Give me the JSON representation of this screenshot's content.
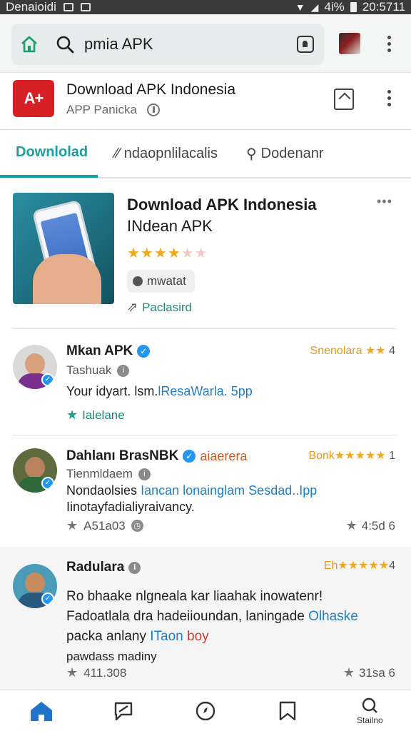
{
  "status_bar": {
    "carrier": "Denaioidi",
    "battery": "4i%",
    "time": "20:5711"
  },
  "browser": {
    "url_text": "pmia APK",
    "icons": [
      "home-icon",
      "search-icon",
      "tab-switch-icon",
      "profile-avatar",
      "overflow-menu-icon"
    ]
  },
  "app_header": {
    "logo_text": "A+",
    "title": "Download APK Indonesia",
    "subtitle": "APP Panicka"
  },
  "tabs": [
    {
      "label": "Downlolad",
      "active": true
    },
    {
      "label": "ndaopnlilacalis",
      "active": false
    },
    {
      "label": "Dodenanr",
      "active": false
    }
  ],
  "featured": {
    "title": "Download APK Indonesia",
    "subtitle": "INdean APK",
    "rating": 3.5,
    "chip_label": "mwatat",
    "link_label": "Paclasird",
    "more": "•••"
  },
  "reviews": [
    {
      "name": "Mkan APK",
      "tag": "",
      "handle": "Tashuak",
      "rating_label": "Snenolara",
      "rating_stars": "★★",
      "rating_num": "4",
      "text_plain": "Your idyart. lsm.",
      "text_link": "lResaWarla. 5pp",
      "action_label": "Ialelane",
      "meta_left": "",
      "meta_right": ""
    },
    {
      "name": "Dahlanı BrasNBK",
      "tag": "aiaerera",
      "handle": "Tienmldaem",
      "rating_label": "Bonk",
      "rating_stars": "★★★★★",
      "rating_num": "1",
      "text_plain": "Nondaolsies",
      "text_link": "Iancan lonainglam Sesdad..Ipp",
      "text_line2": "Iinotayfadialiyraivancy.",
      "meta_left": "A51a03",
      "meta_right": "4:5d 6"
    },
    {
      "name": "Radulara",
      "tag": "",
      "handle": "",
      "rating_label": "Eh",
      "rating_stars": "★★★★★",
      "rating_num": "4",
      "text_line1": "Ro bhaake nlgneala kar liaahak inowatenr!",
      "text_line2_plain": "Fadoatlala dra hadeiioundan, laningade",
      "text_line2_link": "Olhaske",
      "text_line3_plain": "packa anlany",
      "text_line3_link": "ITaon",
      "text_line3_red": "boy",
      "text_line4": "pawdass madiny",
      "meta_left": "411.308",
      "meta_right": "31sa 6"
    }
  ],
  "bottom_nav": {
    "items": [
      {
        "icon": "home-icon",
        "label": ""
      },
      {
        "icon": "chat-icon",
        "label": ""
      },
      {
        "icon": "compass-icon",
        "label": ""
      },
      {
        "icon": "bookmark-icon",
        "label": ""
      },
      {
        "icon": "settings-icon",
        "label": "Stailno"
      }
    ]
  },
  "colors": {
    "accent": "#1a9ea0",
    "star": "#f0a91e",
    "link": "#1d7fc9",
    "logo": "#d71f26"
  }
}
